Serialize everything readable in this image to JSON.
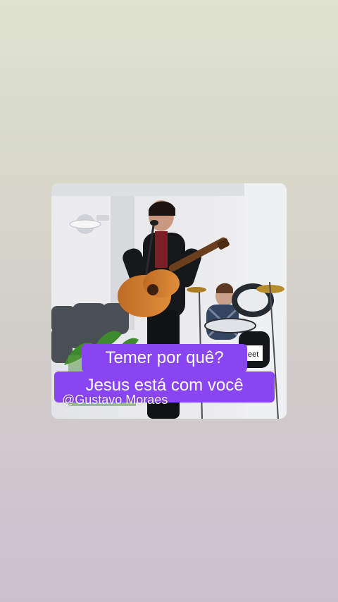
{
  "story": {
    "caption_line_1": "Temer por quê?",
    "caption_line_2": "Jesus está com você",
    "watermark": "@Gustavo Moraes",
    "drum_logo_text": "eet",
    "accent_color": "#8a45f2"
  },
  "scene": {
    "icons": [
      "wall-fan-icon",
      "microphone-icon",
      "acoustic-guitar-icon",
      "drum-kit-icon",
      "plant-icon"
    ]
  }
}
